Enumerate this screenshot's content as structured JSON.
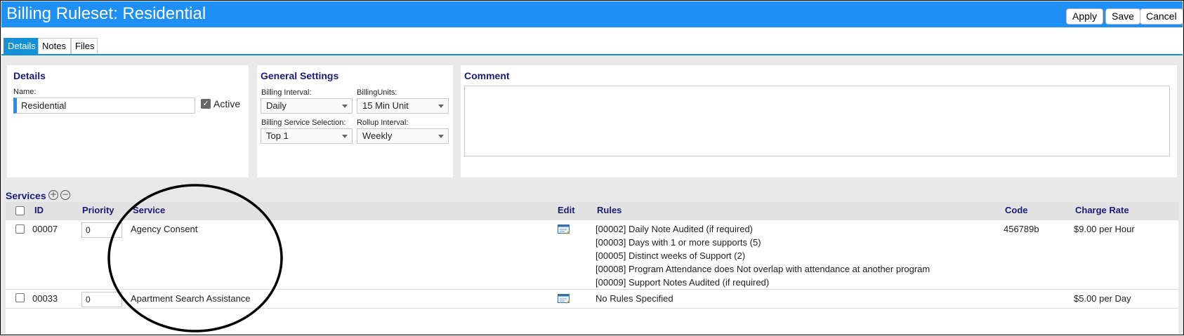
{
  "window": {
    "title": "Billing Ruleset: Residential",
    "buttons": {
      "apply": "Apply",
      "save": "Save",
      "cancel": "Cancel"
    }
  },
  "tabs": [
    {
      "label": "Details",
      "active": true
    },
    {
      "label": "Notes",
      "active": false
    },
    {
      "label": "Files",
      "active": false
    }
  ],
  "details": {
    "title": "Details",
    "name_label": "Name:",
    "name_value": "Residential",
    "active_label": "Active",
    "active_checked": true
  },
  "general": {
    "title": "General Settings",
    "billing_interval": {
      "label": "Billing Interval:",
      "value": "Daily"
    },
    "billing_units": {
      "label": "BillingUnits:",
      "value": "15 Min Unit"
    },
    "service_selection": {
      "label": "Billing Service Selection:",
      "value": "Top 1"
    },
    "rollup_interval": {
      "label": "Rollup Interval:",
      "value": "Weekly"
    }
  },
  "comment": {
    "title": "Comment",
    "value": ""
  },
  "services": {
    "title": "Services",
    "columns": {
      "id": "ID",
      "priority": "Priority",
      "service": "Service",
      "edit": "Edit",
      "rules": "Rules",
      "code": "Code",
      "charge_rate": "Charge Rate"
    },
    "rows": [
      {
        "id": "00007",
        "priority": "0",
        "service": "Agency Consent",
        "rules": [
          "[00002] Daily Note Audited (if required)",
          "[00003] Days with 1 or more supports (5)",
          "[00005] Distinct weeks of Support (2)",
          "[00008] Program Attendance does Not overlap with attendance at another program",
          "[00009] Support Notes Audited (if required)"
        ],
        "code": "456789b",
        "charge_rate": "$9.00 per Hour"
      },
      {
        "id": "00033",
        "priority": "0",
        "service": "Apartment Search Assistance",
        "rules": [
          "No Rules Specified"
        ],
        "code": "",
        "charge_rate": "$5.00 per Day"
      }
    ]
  },
  "colors": {
    "titlebar": "#1e8ff5",
    "tab_active": "#1491d6",
    "heading": "#1a1a7a"
  }
}
